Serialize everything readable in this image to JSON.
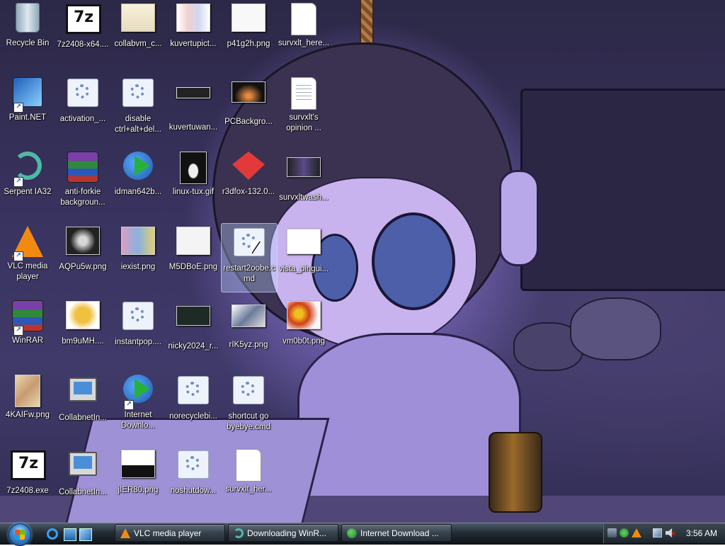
{
  "desktop": {
    "icons": [
      {
        "label": "Recycle Bin",
        "glyph": "recycle-bin-icon"
      },
      {
        "label": "7z2408-x64....",
        "glyph": "7zip-icon"
      },
      {
        "label": "collabvm_c...",
        "glyph": "certificate-icon"
      },
      {
        "label": "kuvertupict...",
        "glyph": "image-icon"
      },
      {
        "label": "p41g2h.png",
        "glyph": "image-icon"
      },
      {
        "label": "survxlt_here...",
        "glyph": "text-file-icon"
      },
      {
        "label": "Paint.NET",
        "glyph": "paint-net-icon"
      },
      {
        "label": "activation_...",
        "glyph": "script-icon"
      },
      {
        "label": "disable ctrl+alt+del...",
        "glyph": "script-icon"
      },
      {
        "label": "kuvertuwan...",
        "glyph": "image-icon"
      },
      {
        "label": "PCBackgro...",
        "glyph": "image-icon"
      },
      {
        "label": "survxlt's opinion ...",
        "glyph": "text-file-icon"
      },
      {
        "label": "Serpent IA32",
        "glyph": "serpent-icon"
      },
      {
        "label": "anti-forkie backgroun...",
        "glyph": "winrar-icon"
      },
      {
        "label": "idman642b...",
        "glyph": "installer-icon"
      },
      {
        "label": "linux-tux.gif",
        "glyph": "image-icon"
      },
      {
        "label": "r3dfox-132.0...",
        "glyph": "r3dfox-icon"
      },
      {
        "label": "survxltwash...",
        "glyph": "image-icon"
      },
      {
        "label": "VLC media player",
        "glyph": "vlc-icon"
      },
      {
        "label": "AQPu5w.png",
        "glyph": "image-icon"
      },
      {
        "label": "iexist.png",
        "glyph": "image-icon"
      },
      {
        "label": "M5DBoE.png",
        "glyph": "image-icon"
      },
      {
        "label": "restart2oobe.cmd",
        "glyph": "script-icon"
      },
      {
        "label": "vista_pingui...",
        "glyph": "image-icon"
      },
      {
        "label": "WinRAR",
        "glyph": "winrar-icon"
      },
      {
        "label": "bm9uMH....",
        "glyph": "image-icon"
      },
      {
        "label": "instantpop....",
        "glyph": "script-icon"
      },
      {
        "label": "nicky2024_r...",
        "glyph": "image-icon"
      },
      {
        "label": "rIK5yz.png",
        "glyph": "image-icon"
      },
      {
        "label": "vm0b0t.png",
        "glyph": "image-icon"
      },
      {
        "label": "4KAIFw.png",
        "glyph": "image-icon"
      },
      {
        "label": "CollabnetIn...",
        "glyph": "computer-icon"
      },
      {
        "label": "Internet Downlo...",
        "glyph": "idm-icon"
      },
      {
        "label": "norecyclebi...",
        "glyph": "script-icon"
      },
      {
        "label": "shortcut go byebye.cmd",
        "glyph": "script-icon"
      },
      {
        "label": "7z2408.exe",
        "glyph": "7zip-icon"
      },
      {
        "label": "CollabnetIn...",
        "glyph": "computer-icon"
      },
      {
        "label": "jIER80.png",
        "glyph": "image-icon"
      },
      {
        "label": "noshutdow...",
        "glyph": "script-icon"
      },
      {
        "label": "survxlt_her...",
        "glyph": "text-file-icon"
      }
    ]
  },
  "taskbar": {
    "start_icon": "windows-orb-icon",
    "tasks": [
      {
        "label": "VLC media player",
        "icon": "vlc-icon"
      },
      {
        "label": "Downloading WinR...",
        "icon": "serpent-icon"
      },
      {
        "label": "Internet Download ...",
        "icon": "idm-icon"
      }
    ],
    "clock": "3:56 AM"
  }
}
